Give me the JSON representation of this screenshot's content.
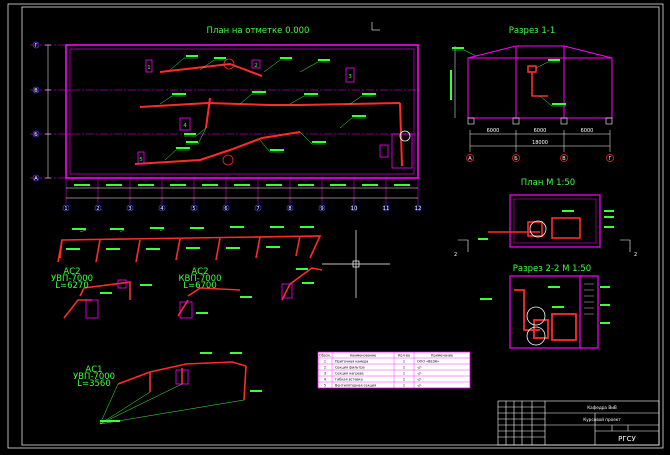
{
  "titles": {
    "plan": "План на отметке 0.000",
    "section_1_1": "Разрез 1-1",
    "plan_m150": "План М 1:50",
    "section_2_2": "Разрез 2-2 М 1:50"
  },
  "plan": {
    "col_axes": [
      "1",
      "2",
      "3",
      "4",
      "5",
      "6",
      "7",
      "8",
      "9",
      "10",
      "11",
      "12"
    ],
    "row_axes": [
      "Г",
      "В",
      "Б",
      "А"
    ],
    "equipment_tags": [
      "1",
      "2",
      "3",
      "4",
      "5"
    ]
  },
  "section_1_1": {
    "spans": [
      "6000",
      "6000",
      "6000"
    ],
    "total": "18000",
    "axes": [
      "А",
      "Б",
      "В",
      "Г"
    ]
  },
  "systems": {
    "system_1": {
      "name": "АС2",
      "unit": "УВП-7000",
      "length": "L=6270"
    },
    "system_2": {
      "name": "АС2",
      "unit": "КВП-7000",
      "length": "L=6700"
    },
    "system_3": {
      "name": "АС1",
      "unit": "УВП-7000",
      "length": "L=3560"
    }
  },
  "spec_table": {
    "headers": [
      "Обозн.",
      "Наименование",
      "Кол-во",
      "Примечание"
    ],
    "rows": [
      [
        "1",
        "Приточная камера",
        "1",
        "ООО «ВЕЗА»"
      ],
      [
        "2",
        "Секция фильтра",
        "1",
        "-//-"
      ],
      [
        "3",
        "Секция нагрева",
        "1",
        "-//-"
      ],
      [
        "4",
        "Гибкая вставка",
        "2",
        "-//-"
      ],
      [
        "5",
        "Вентиляторная секция",
        "1",
        "-//-"
      ]
    ]
  },
  "title_block": {
    "line_1": "Кафедра ВиВ",
    "line_2": "Курсовой проект",
    "org": "РГСУ"
  },
  "colors": {
    "background": "#000000",
    "frame": "#ffffff",
    "walls": "#ff00ff",
    "ducts": "#ff2a2a",
    "labels": "#3cff3c",
    "dims": "#ffffff"
  }
}
